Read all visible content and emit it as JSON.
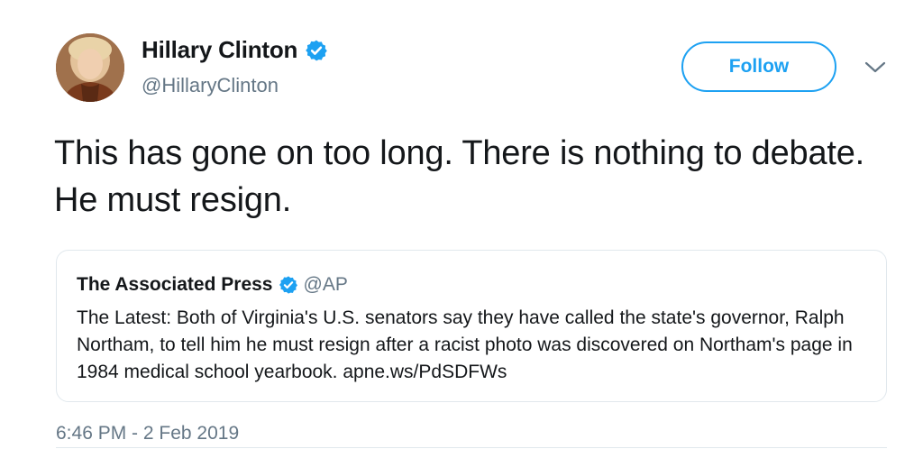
{
  "author": {
    "display_name": "Hillary Clinton",
    "handle": "@HillaryClinton",
    "avatar_icon": "profile-photo",
    "verified_icon": "verified-badge-icon"
  },
  "actions": {
    "follow_label": "Follow",
    "more_icon": "chevron-down-icon"
  },
  "tweet": {
    "text": "This has gone on too long. There is nothing to debate. He must resign.",
    "timestamp": "6:46 PM - 2 Feb 2019"
  },
  "quoted_tweet": {
    "display_name": "The Associated Press",
    "handle": "@AP",
    "text": "The Latest: Both of Virginia's U.S. senators say they have called the state's governor, Ralph Northam, to tell him he must resign after a racist photo was discovered on Northam's page in 1984 medical school yearbook. apne.ws/PdSDFWs"
  },
  "colors": {
    "accent": "#1da1f2",
    "text": "#14171a",
    "muted": "#657786",
    "border": "#e1e8ed"
  }
}
